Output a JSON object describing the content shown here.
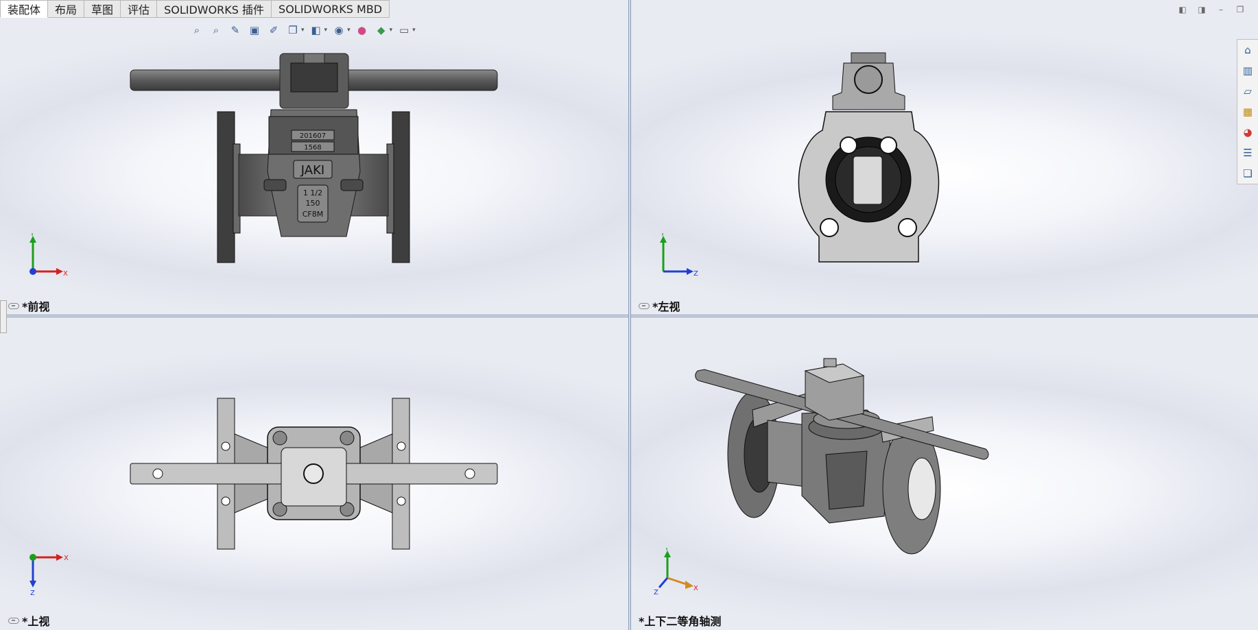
{
  "tabs": [
    {
      "label": "装配体",
      "active": true
    },
    {
      "label": "布局",
      "active": false
    },
    {
      "label": "草图",
      "active": false
    },
    {
      "label": "评估",
      "active": false
    },
    {
      "label": "SOLIDWORKS 插件",
      "active": false
    },
    {
      "label": "SOLIDWORKS MBD",
      "active": false
    }
  ],
  "hud_icons": [
    "zoom-to-fit-icon",
    "zoom-to-area-icon",
    "previous-view-icon",
    "section-view-icon",
    "dynamic-annotation-icon",
    "view-orientation-icon",
    "display-style-icon",
    "hide-show-items-icon",
    "edit-appearance-icon",
    "apply-scene-icon",
    "view-settings-icon"
  ],
  "window_controls": [
    "tile-left-icon",
    "tile-right-icon",
    "minimize-icon",
    "restore-icon"
  ],
  "task_pane": [
    "home-icon",
    "design-library-icon",
    "file-explorer-icon",
    "view-palette-icon",
    "appearances-icon",
    "custom-properties-icon",
    "forum-icon"
  ],
  "views": {
    "front": {
      "label": "*前视",
      "axis_a": "Y",
      "axis_b": "X"
    },
    "left": {
      "label": "*左视",
      "axis_a": "Y",
      "axis_b": "Z"
    },
    "top": {
      "label": "*上视",
      "axis_a": "X",
      "axis_b": "Z"
    },
    "iso": {
      "label": "*上下二等角轴测",
      "axis_a": "Y",
      "axis_b": "X",
      "axis_c": "Z"
    }
  },
  "engravings": {
    "line1": "201607",
    "line2": "1568",
    "brand": "JAKI",
    "size": "1 1/2",
    "class": "150",
    "material": "CF8M"
  },
  "colors": {
    "body": "#6f6f6f",
    "dark": "#3e3e3e",
    "light": "#9a9a9a",
    "face": "#c9c9c9",
    "axis_x": "#d42020",
    "axis_y": "#1aa01a",
    "axis_z": "#2040d0"
  }
}
